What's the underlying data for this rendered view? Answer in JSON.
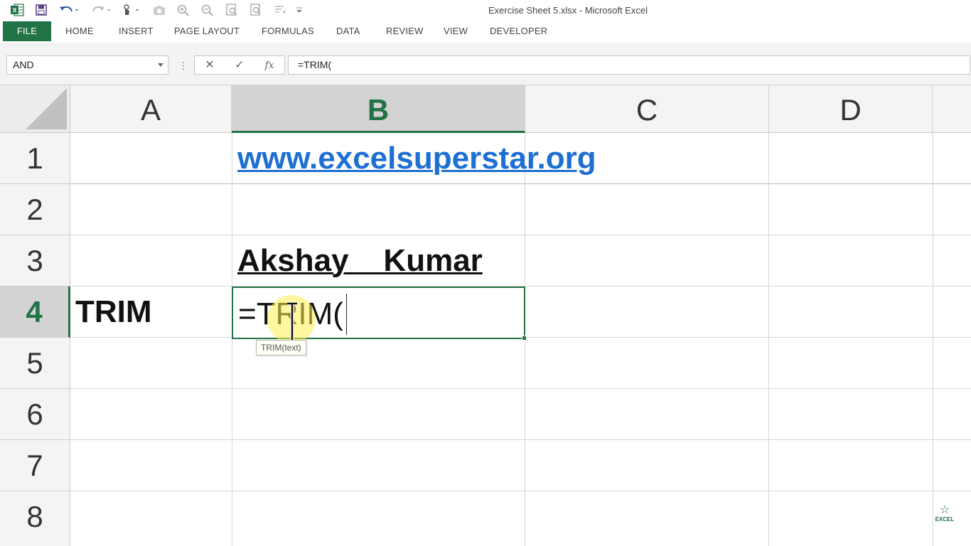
{
  "window": {
    "title": "Exercise Sheet 5.xlsx - Microsoft Excel"
  },
  "quick_access": [
    {
      "name": "excel-logo-icon"
    },
    {
      "name": "save-icon"
    },
    {
      "name": "undo-icon"
    },
    {
      "name": "redo-icon"
    },
    {
      "name": "touch-mode-icon"
    },
    {
      "name": "camera-icon"
    },
    {
      "name": "zoom-in-icon"
    },
    {
      "name": "zoom-out-icon"
    },
    {
      "name": "print-preview-icon"
    },
    {
      "name": "page-preview-icon"
    },
    {
      "name": "sort-icon"
    },
    {
      "name": "customize-qat-icon"
    }
  ],
  "ribbon": {
    "file": "FILE",
    "tabs": [
      "HOME",
      "INSERT",
      "PAGE LAYOUT",
      "FORMULAS",
      "DATA",
      "REVIEW",
      "VIEW",
      "DEVELOPER"
    ]
  },
  "formula_bar": {
    "name_box": "AND",
    "cancel_icon": "✕",
    "enter_icon": "✓",
    "fx_icon": "fx",
    "formula": "=TRIM("
  },
  "sheet": {
    "columns": [
      "A",
      "B",
      "C",
      "D"
    ],
    "active_column": "B",
    "rows": [
      "1",
      "2",
      "3",
      "4",
      "5",
      "6",
      "7",
      "8"
    ],
    "active_row": "4",
    "cells": {
      "B1": "www.excelsuperstar.org",
      "B3": "Akshay    Kumar",
      "A4": "TRIM",
      "B4": "=TRIM("
    },
    "tooltip": "TRIM(text)"
  },
  "watermark": {
    "label": "EXCEL"
  },
  "colors": {
    "excel_green": "#217346",
    "hyperlink_blue": "#1d6fd1"
  }
}
